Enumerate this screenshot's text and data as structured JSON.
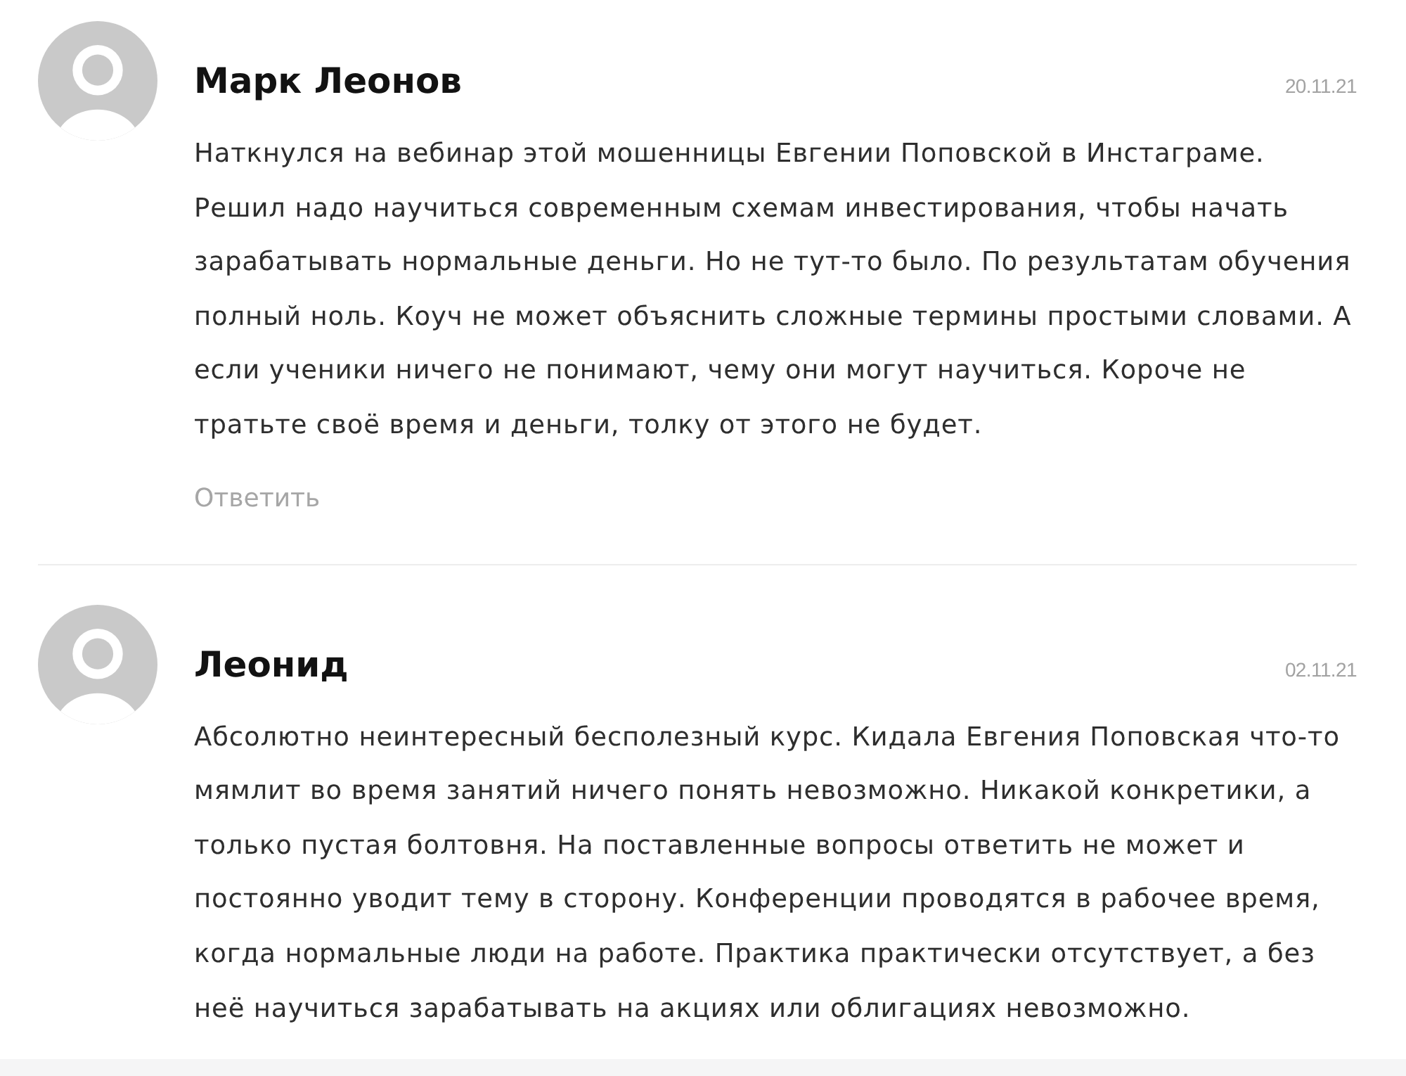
{
  "comments": [
    {
      "author": "Марк Леонов",
      "date": "20.11.21",
      "text": "Наткнулся на вебинар этой мошенницы Евгении Поповской в Инстаграме. Решил надо научиться современным схемам инвестирования, чтобы начать зарабатывать нормальные деньги. Но не тут-то было. По результатам обучения полный ноль. Коуч не может объяснить сложные термины простыми словами. А если ученики ничего не понимают, чему они могут научиться. Короче не тратьте своё время и деньги, толку от этого не будет.",
      "reply_label": "Ответить"
    },
    {
      "author": "Леонид",
      "date": "02.11.21",
      "text": "Абсолютно неинтересный бесполезный курс. Кидала Евгения Поповская что-то мямлит во время занятий ничего понять невозможно. Никакой конкретики, а только пустая болтовня. На поставленные вопросы ответить не может и постоянно уводит тему в сторону. Конференции проводятся в рабочее время, когда нормальные люди на работе. Практика практически отсутствует, а без неё научиться зарабатывать на акциях или облигациях невозможно."
    }
  ]
}
